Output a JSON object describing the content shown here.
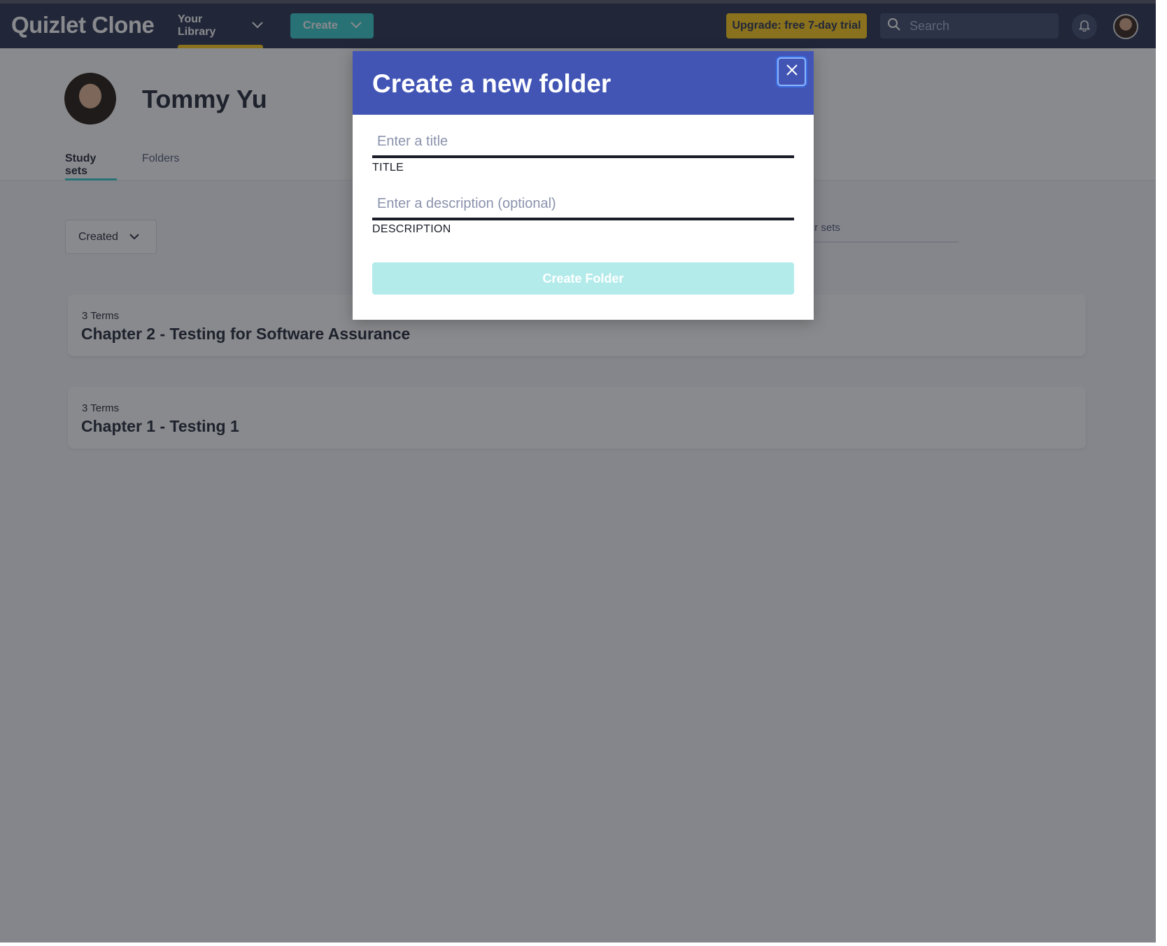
{
  "navbar": {
    "logo": "Quizlet Clone",
    "library_label": "Your Library",
    "create_label": "Create",
    "upgrade_label": "Upgrade: free 7-day trial",
    "search_placeholder": "Search"
  },
  "profile": {
    "name": "Tommy Yu",
    "tabs": [
      {
        "label": "Study sets",
        "active": true
      },
      {
        "label": "Folders",
        "active": false
      }
    ]
  },
  "library": {
    "sort_label": "Created",
    "filter_placeholder": "your sets",
    "sets": [
      {
        "terms": "3 Terms",
        "title": "Chapter 2 - Testing for Software Assurance"
      },
      {
        "terms": "3 Terms",
        "title": "Chapter 1 - Testing 1"
      }
    ]
  },
  "modal": {
    "title": "Create a new folder",
    "title_placeholder": "Enter a title",
    "title_label": "TITLE",
    "description_placeholder": "Enter a description (optional)",
    "description_label": "DESCRIPTION",
    "submit_label": "Create Folder"
  },
  "colors": {
    "navbar": "#2e3856",
    "accent": "#3ccfcf",
    "upgrade": "#ffcd1f",
    "modal_header": "#4255b5"
  },
  "icons": [
    "chevron-down-icon",
    "search-icon",
    "bell-icon",
    "close-icon"
  ]
}
